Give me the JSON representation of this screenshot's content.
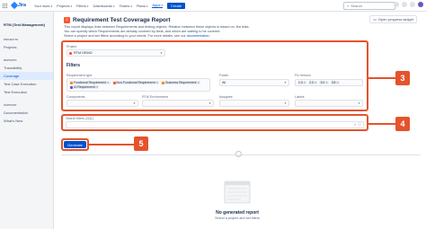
{
  "topnav": {
    "logo": "Jira",
    "items": [
      {
        "label": "Your work"
      },
      {
        "label": "Projects"
      },
      {
        "label": "Filters"
      },
      {
        "label": "Dashboards"
      },
      {
        "label": "Teams"
      },
      {
        "label": "Plans"
      },
      {
        "label": "Apps"
      }
    ],
    "create_label": "Create",
    "search_placeholder": "Search"
  },
  "sidebar": {
    "title": "RTM (Test Management)",
    "sections": [
      {
        "heading": "PROJECTS",
        "items": [
          {
            "label": "Projects"
          }
        ]
      },
      {
        "heading": "REPORTS",
        "items": [
          {
            "label": "Traceability"
          },
          {
            "label": "Coverage"
          },
          {
            "label": "Test Case Execution"
          },
          {
            "label": "Test Execution"
          }
        ]
      },
      {
        "heading": "SUPPORT",
        "items": [
          {
            "label": "Documentation"
          },
          {
            "label": "What's New"
          }
        ]
      }
    ],
    "active_item": "Coverage"
  },
  "main": {
    "title": "Requirement Test Coverage Report",
    "progress_button": "Open progress widget",
    "description_lines": [
      "This report displays links between Requirements and testing objects. Relation between these objects is based on Jira links.",
      "You can specify which Requirements are already covered by tests, and which are waiting to be covered.",
      "Select a project and set filters according to your needs. For more details, see our"
    ],
    "description_link": "documentation.",
    "project_label": "Project",
    "project_value": "RTM DEMO",
    "filters_title": "Filters",
    "requirement_type_label": "Requirement type",
    "requirement_chips": [
      {
        "label": "Functional Requirement",
        "color": "#ff8b00"
      },
      {
        "label": "Non-Functional Requirement",
        "color": "#ff5630"
      },
      {
        "label": "Business Requirement",
        "color": "#ff8b00"
      },
      {
        "label": "UI Requirement",
        "color": "#6554c0"
      }
    ],
    "folder_label": "Folder",
    "folder_value": "All",
    "fix_version_label": "Fix Version",
    "fix_version_chips": [
      {
        "label": "1.0"
      },
      {
        "label": "2.0"
      },
      {
        "label": "3.0"
      },
      {
        "label": "3.5"
      }
    ],
    "components_label": "Components",
    "rtm_env_label": "RTM Environment",
    "assignee_label": "Assignee",
    "labels_label": "Labels",
    "search_filters_label": "Search filters (JQL)",
    "generate_label": "Generate",
    "empty_title": "No generated report",
    "empty_sub": "Select a project and set filters",
    "badges": {
      "filters": "3",
      "jql": "4",
      "generate": "5"
    }
  }
}
